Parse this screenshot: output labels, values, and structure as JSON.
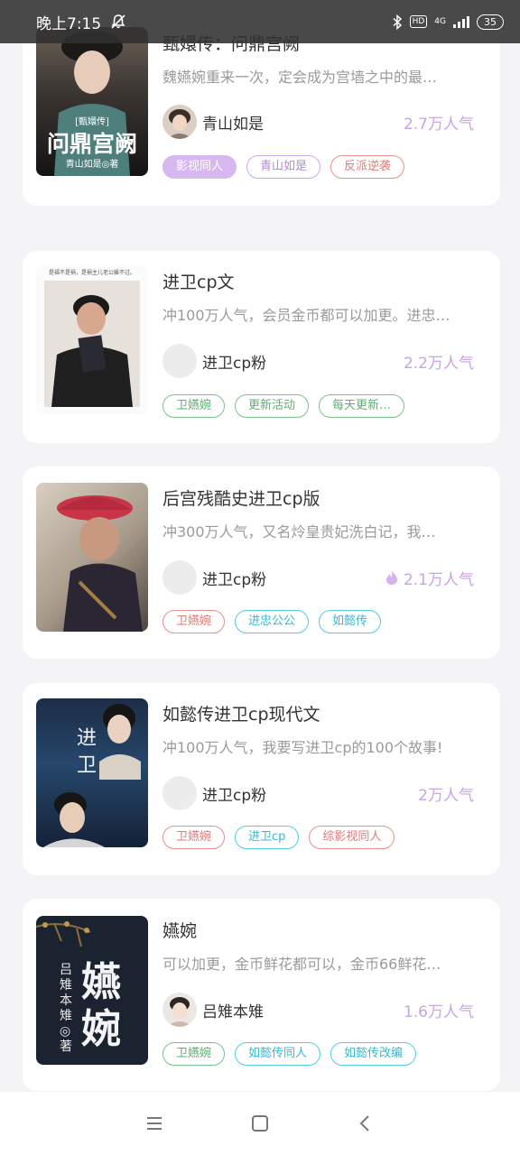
{
  "status_bar": {
    "time": "晚上7:15",
    "network": "4G",
    "hd": "HD",
    "battery": "35"
  },
  "cards": [
    {
      "title": "甄嬛传：问鼎宫阙",
      "desc": "魏嬿婉重来一次，定会成为宫墙之中的最…",
      "author": "青山如是",
      "popularity": "2.7万人气",
      "tags": [
        "影视同人",
        "青山如是",
        "反派逆袭"
      ],
      "cover_text": {
        "series": "[甄嬛传]",
        "title": "问鼎宫阙",
        "author": "青山如是◎著"
      }
    },
    {
      "title": "进卫cp文",
      "desc": "冲100万人气，会员金币都可以加更。进忠…",
      "author": "进卫cp粉",
      "popularity": "2.2万人气",
      "tags": [
        "卫嬿婉",
        "更新活动",
        "每天更新…"
      ],
      "cover_text": {
        "top": "是福不是祸，是祸主儿老公躲不过。"
      }
    },
    {
      "title": "后宫残酷史进卫cp版",
      "desc": "冲300万人气，又名炩皇贵妃洗白记，我…",
      "author": "进卫cp粉",
      "popularity": "2.1万人气",
      "tags": [
        "卫嬿婉",
        "进忠公公",
        "如懿传"
      ]
    },
    {
      "title": "如懿传进卫cp现代文",
      "desc": "冲100万人气，我要写进卫cp的100个故事!",
      "author": "进卫cp粉",
      "popularity": "2万人气",
      "tags": [
        "卫嬿婉",
        "进卫cp",
        "综影视同人"
      ],
      "cover_text": {
        "title": "进卫"
      }
    },
    {
      "title": "嬿婉",
      "desc": "可以加更，金币鲜花都可以，金币66鲜花…",
      "author": "吕雉本雉",
      "popularity": "1.6万人气",
      "tags": [
        "卫嬿婉",
        "如懿传同人",
        "如懿传改编"
      ],
      "cover_text": {
        "title": "嬿婉",
        "author": "吕雉本雉◎著"
      }
    }
  ]
}
